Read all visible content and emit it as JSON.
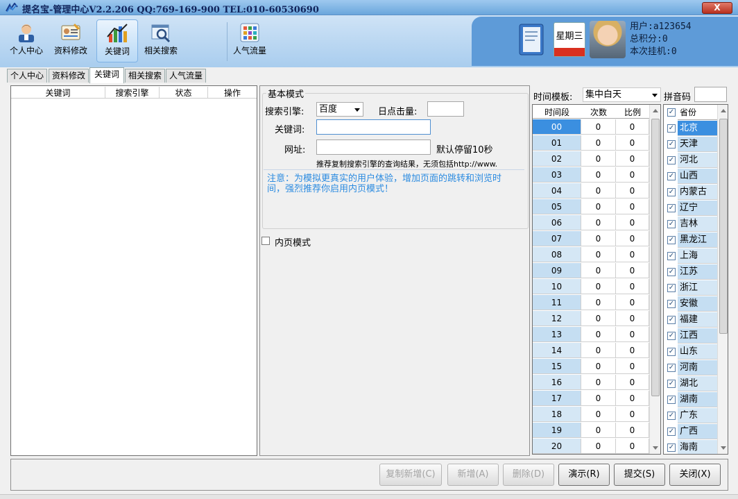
{
  "window": {
    "title": "提名宝-管理中心V2.2.206    QQ:769-169-900   TEL:010-60530690",
    "close_label": "X"
  },
  "toolbar": {
    "items": [
      {
        "label": "个人中心",
        "icon": "person-icon"
      },
      {
        "label": "资料修改",
        "icon": "id-card-icon"
      },
      {
        "label": "关键词",
        "icon": "bar-chart-icon"
      },
      {
        "label": "相关搜索",
        "icon": "magnifier-icon"
      },
      {
        "label": "人气流量",
        "icon": "grid-app-icon"
      }
    ],
    "active_index": 2
  },
  "user": {
    "calendar_label": "星期三",
    "username": "用户:a123654",
    "total_points": "总积分:0",
    "session_hangup": "本次挂机:0"
  },
  "tabs": [
    "个人中心",
    "资料修改",
    "关键词",
    "相关搜索",
    "人气流量"
  ],
  "active_tab": 2,
  "keyword_list": {
    "columns": [
      "关键词",
      "搜索引擎",
      "状态",
      "操作"
    ]
  },
  "basic_mode": {
    "group_title": "基本模式",
    "engine_label": "搜索引擎:",
    "engine_value": "百度",
    "daily_clicks_label": "日点击量:",
    "daily_clicks_value": "",
    "keyword_label": "关键词:",
    "keyword_value": "",
    "url_label": "网址:",
    "url_value": "",
    "stay_note": "默认停留10秒",
    "url_hint": "推荐复制搜索引擎的查询结果，无须包括http://www.",
    "notice": "注意：为模拟更真实的用户体验，增加页面的跳转和浏览时间，强烈推荐你启用内页模式！",
    "inner_page_label": "内页模式",
    "inner_page_checked": false
  },
  "time_template": {
    "label": "时间模板:",
    "value": "集中白天",
    "pinyin_label": "拼音码",
    "pinyin_value": "",
    "columns": [
      "时间段",
      "次数",
      "比例"
    ],
    "rows": [
      {
        "slot": "00",
        "count": "0",
        "ratio": "0"
      },
      {
        "slot": "01",
        "count": "0",
        "ratio": "0"
      },
      {
        "slot": "02",
        "count": "0",
        "ratio": "0"
      },
      {
        "slot": "03",
        "count": "0",
        "ratio": "0"
      },
      {
        "slot": "04",
        "count": "0",
        "ratio": "0"
      },
      {
        "slot": "05",
        "count": "0",
        "ratio": "0"
      },
      {
        "slot": "06",
        "count": "0",
        "ratio": "0"
      },
      {
        "slot": "07",
        "count": "0",
        "ratio": "0"
      },
      {
        "slot": "08",
        "count": "0",
        "ratio": "0"
      },
      {
        "slot": "09",
        "count": "0",
        "ratio": "0"
      },
      {
        "slot": "10",
        "count": "0",
        "ratio": "0"
      },
      {
        "slot": "11",
        "count": "0",
        "ratio": "0"
      },
      {
        "slot": "12",
        "count": "0",
        "ratio": "0"
      },
      {
        "slot": "13",
        "count": "0",
        "ratio": "0"
      },
      {
        "slot": "14",
        "count": "0",
        "ratio": "0"
      },
      {
        "slot": "15",
        "count": "0",
        "ratio": "0"
      },
      {
        "slot": "16",
        "count": "0",
        "ratio": "0"
      },
      {
        "slot": "17",
        "count": "0",
        "ratio": "0"
      },
      {
        "slot": "18",
        "count": "0",
        "ratio": "0"
      },
      {
        "slot": "19",
        "count": "0",
        "ratio": "0"
      },
      {
        "slot": "20",
        "count": "0",
        "ratio": "0"
      }
    ],
    "selected_index": 0
  },
  "provinces": {
    "header": "省份",
    "items": [
      "北京",
      "天津",
      "河北",
      "山西",
      "内蒙古",
      "辽宁",
      "吉林",
      "黑龙江",
      "上海",
      "江苏",
      "浙江",
      "安徽",
      "福建",
      "江西",
      "山东",
      "河南",
      "湖北",
      "湖南",
      "广东",
      "广西",
      "海南"
    ],
    "selected_index": 0
  },
  "buttons": {
    "copy_add": "复制新增(C)",
    "add": "新增(A)",
    "delete": "删除(D)",
    "demo": "演示(R)",
    "submit": "提交(S)",
    "close": "关闭(X)"
  }
}
